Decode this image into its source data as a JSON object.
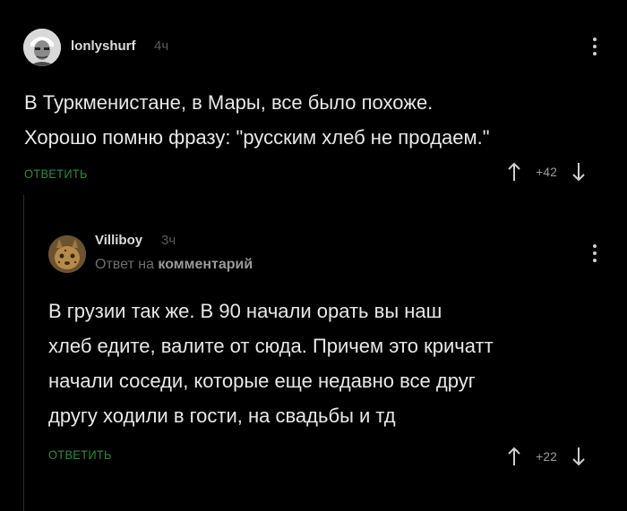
{
  "comments": [
    {
      "username": "lonlyshurf",
      "time": "4ч",
      "lines": [
        "В Туркменистане, в Мары, все было похоже.",
        "Хорошо помню фразу: \"русским хлеб не продаем.\""
      ],
      "reply_label": "ОТВЕТИТЬ",
      "score": "+42"
    },
    {
      "username": "Villiboy",
      "time": "3ч",
      "reply_to_prefix": "Ответ на",
      "reply_to_target": "комментарий",
      "lines": [
        "В грузии так же. В 90 начали орать вы наш",
        "хлеб едите, валите от сюда. Причем это кричатт",
        "начали соседи, которые еще недавно все друг",
        "другу ходили в гости, на свадьбы и тд"
      ],
      "reply_label": "ОТВЕТИТЬ",
      "score": "+22"
    }
  ],
  "colors": {
    "background": "#000000",
    "reply_link": "#2e8b3e",
    "text": "#e8e8e8",
    "muted": "#5a5a5a"
  },
  "icons": [
    "avatar",
    "more-vert-icon",
    "arrow-up-icon",
    "arrow-down-icon"
  ]
}
